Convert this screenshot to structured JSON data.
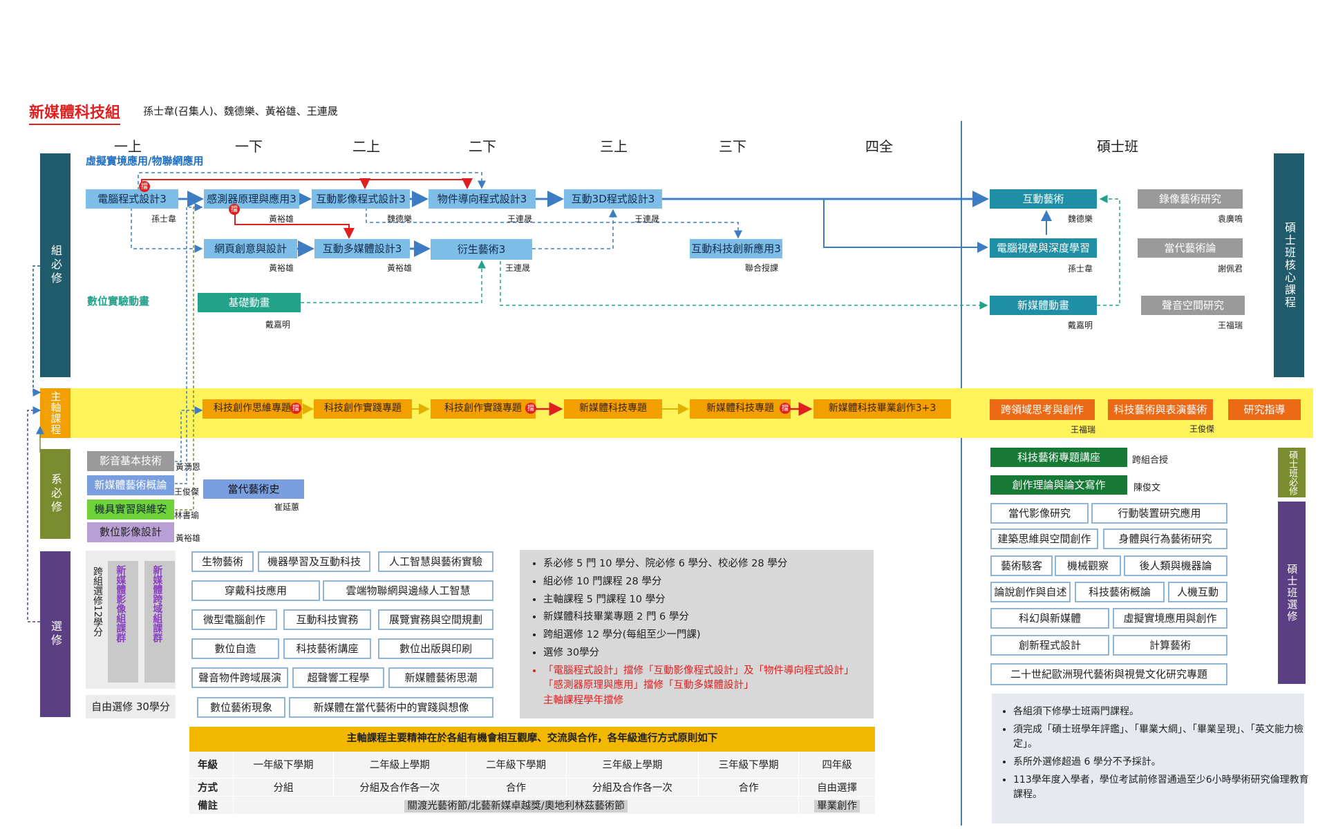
{
  "header": {
    "title": "新媒體科技組",
    "members": "孫士韋(召集人)、魏德樂、黃裕雄、王連晟"
  },
  "years": [
    "一上",
    "一下",
    "二上",
    "二下",
    "三上",
    "三下",
    "四全",
    "碩士班"
  ],
  "side_labels": {
    "group_required": "組必修",
    "main_axis": "主軸課程",
    "dept_required": "系必修",
    "elective": "選修",
    "master_core": "碩士班核心課程",
    "master_required": "碩士班必修",
    "master_elective": "碩士班選修"
  },
  "tracks": {
    "vr": "虛擬實境應用/物聯網應用",
    "animation": "數位實驗動畫"
  },
  "courses": [
    {
      "name": "電腦程式設計3",
      "prof": "孫士韋"
    },
    {
      "name": "感測器原理與應用3",
      "prof": "黃裕雄"
    },
    {
      "name": "互動影像程式設計3",
      "prof": "魏德樂"
    },
    {
      "name": "物件導向程式設計3",
      "prof": "王連晟"
    },
    {
      "name": "互動3D程式設計3",
      "prof": "王連晟"
    },
    {
      "name": "網頁創意與設計",
      "prof": "黃裕雄"
    },
    {
      "name": "互動多媒體設計3",
      "prof": "黃裕雄"
    },
    {
      "name": "衍生藝術3",
      "prof": "王連晟"
    },
    {
      "name": "互動科技創新應用3",
      "prof": "聯合授課"
    },
    {
      "name": "基礎動畫",
      "prof": "戴嘉明"
    }
  ],
  "master_core": [
    {
      "name": "互動藝術",
      "prof": "魏德樂"
    },
    {
      "name": "電腦視覺與深度學習",
      "prof": "孫士韋"
    },
    {
      "name": "新媒體動畫",
      "prof": "戴嘉明"
    },
    {
      "name": "錄像藝術研究",
      "prof": "袁廣鳴"
    },
    {
      "name": "當代藝術論",
      "prof": "謝佩君"
    },
    {
      "name": "聲音空間研究",
      "prof": "王福瑞"
    }
  ],
  "badge": "擋",
  "main_axis": [
    "科技創作思維專題",
    "科技創作實踐專題",
    "科技創作實踐專題",
    "新媒體科技專題",
    "新媒體科技專題",
    "新媒體科技畢業創作3+3"
  ],
  "master_axis": [
    {
      "name": "跨領域思考與創作",
      "prof": "王福瑞"
    },
    {
      "name": "科技藝術與表演藝術",
      "prof": "王俊傑"
    },
    {
      "name": "研究指導",
      "prof": ""
    }
  ],
  "dept_required": [
    {
      "name": "影音基本技術",
      "prof": "黃湧恩"
    },
    {
      "name": "新媒體藝術概論",
      "prof": "王俊傑"
    },
    {
      "name": "機具實習與維安",
      "prof": "林書瑜"
    },
    {
      "name": "數位影像設計",
      "prof": "黃裕雄"
    }
  ],
  "art_history": {
    "name": "當代藝術史",
    "prof": "崔延蕙"
  },
  "cross_group": {
    "label": "跨組選修12學分",
    "cluster1": "新媒體影像組課群",
    "cluster2": "新媒體跨域組課群",
    "free": "自由選修 30學分"
  },
  "electives": [
    [
      "生物藝術",
      "機器學習及互動科技",
      "人工智慧與藝術實驗"
    ],
    [
      "穿戴科技應用",
      "雲端物聯網與邊緣人工智慧"
    ],
    [
      "微型電腦創作",
      "互動科技實務",
      "展覽實務與空間規劃"
    ],
    [
      "數位自造",
      "科技藝術講座",
      "數位出版與印刷"
    ],
    [
      "聲音物件跨域展演",
      "超聲響工程學",
      "新媒體藝術思潮"
    ],
    [
      "數位藝術現象",
      "新媒體在當代藝術中的實踐與想像"
    ]
  ],
  "credit_notes": [
    "系必修 5 門 10 學分、院必修 6 學分、校必修 28 學分",
    "組必修 10 門課程 28 學分",
    "主軸課程 5 門課程 10 學分",
    "新媒體科技畢業專題 2 門 6 學分",
    "跨組選修 12 學分(每組至少一門課)",
    "選修 30學分"
  ],
  "credit_notes_red": [
    "「電腦程式設計」擋修「互動影像程式設計」及「物件導向程式設計」",
    "「感測器原理與應用」擋修「互動多媒體設計」",
    "主軸課程學年擋修"
  ],
  "master_required": [
    {
      "name": "科技藝術專題講座",
      "prof": "跨組合授"
    },
    {
      "name": "創作理論與論文寫作",
      "prof": "陳俊文"
    }
  ],
  "master_electives": [
    [
      "當代影像研究",
      "行動裝置研究應用"
    ],
    [
      "建築思維與空間創作",
      "身體與行為藝術研究"
    ],
    [
      "藝術駭客",
      "機械觀察",
      "後人類與機器論"
    ],
    [
      "論說創作與自述",
      "科技藝術概論",
      "人機互動"
    ],
    [
      "科幻與新媒體",
      "虛擬實境應用與創作"
    ],
    [
      "創新程式設計",
      "計算藝術"
    ],
    [
      "二十世紀歐洲現代藝術與視覺文化研究專題"
    ]
  ],
  "master_notes": [
    "各組須下修學士班兩門課程。",
    "須完成「碩士班學年評鑑」、「畢業大綱」、「畢業呈現」、「英文能力檢定」。",
    "系所外選修超過 6 學分不予採計。",
    "113學年度入學者，學位考試前修習通過至少6小時學術研究倫理教育課程。"
  ],
  "bottom_table": {
    "title": "主軸課程主要精神在於各組有機會相互觀摩、交流與合作，各年級進行方式原則如下",
    "row_labels": [
      "年級",
      "方式",
      "備註"
    ],
    "grades": [
      "一年級下學期",
      "二年級上學期",
      "二年級下學期",
      "三年級上學期",
      "三年級下學期",
      "四年級"
    ],
    "modes": [
      "分組",
      "分組及合作各一次",
      "合作",
      "分組及合作各一次",
      "合作",
      "自由選擇"
    ],
    "remark": "關渡光藝術節/北藝新媒卓越獎/奧地利林茲藝術節",
    "remark_last": "畢業創作"
  },
  "colors": {
    "blue": "#7dbde8",
    "teal": "#1f8fa6",
    "green": "#23a28a",
    "orange": "#f2a000",
    "yellow_band": "#fff35c",
    "red": "#e02020"
  }
}
